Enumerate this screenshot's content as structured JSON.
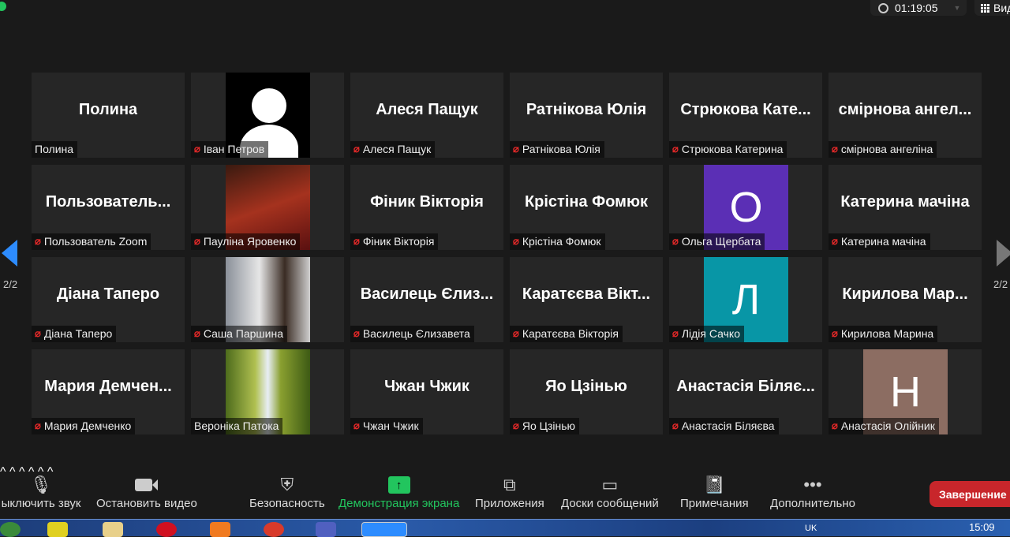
{
  "header": {
    "timer": "01:19:05",
    "view_label": "Вид"
  },
  "pagination": {
    "left": "2/2",
    "right": "2/2"
  },
  "colors": {
    "accent": "#2d8cff",
    "mute": "#e02828",
    "share": "#22c55e",
    "end": "#c8262b"
  },
  "tiles": [
    {
      "display": "Полина",
      "label": "Полина",
      "muted": false,
      "type": "text"
    },
    {
      "display": "",
      "label": "Іван Петров",
      "muted": true,
      "type": "avatar"
    },
    {
      "display": "Алеся Пащук",
      "label": "Алеся Пащук",
      "muted": true,
      "type": "text"
    },
    {
      "display": "Ратнікова Юлія",
      "label": "Ратнікова Юлія",
      "muted": true,
      "type": "text"
    },
    {
      "display": "Стрюкова Кате...",
      "label": "Стрюкова Катерина",
      "muted": true,
      "type": "text"
    },
    {
      "display": "смірнова ангел...",
      "label": "смірнова ангеліна",
      "muted": true,
      "type": "text"
    },
    {
      "display": "Пользователь...",
      "label": "Пользователь Zoom",
      "muted": true,
      "type": "text"
    },
    {
      "display": "",
      "label": "Пауліна Яровенко",
      "muted": true,
      "type": "photo",
      "bg": "linear-gradient(160deg,#3a1a10,#a5321e 50%,#5a1010)"
    },
    {
      "display": "Фіник Вікторія",
      "label": "Фіник Вікторія",
      "muted": true,
      "type": "text"
    },
    {
      "display": "Крістіна Фомюк",
      "label": "Крістіна Фомюк",
      "muted": true,
      "type": "text"
    },
    {
      "display": "О",
      "label": "Ольга Щербата",
      "muted": true,
      "type": "letter",
      "bg": "#5b2fb5"
    },
    {
      "display": "Катерина мачіна",
      "label": "Катерина мачіна",
      "muted": true,
      "type": "text"
    },
    {
      "display": "Діана Таперо",
      "label": "Діана Таперо",
      "muted": true,
      "type": "text"
    },
    {
      "display": "",
      "label": "Саша Паршина",
      "muted": true,
      "type": "photo",
      "bg": "linear-gradient(90deg,#8a9099,#e6e6e6 40%,#3a2c24 70%,#cfcfcf)"
    },
    {
      "display": "Василець Єлиз...",
      "label": "Василець Єлизавета",
      "muted": true,
      "type": "text"
    },
    {
      "display": "Каратєєва Вікт...",
      "label": "Каратєєва Вікторія",
      "muted": true,
      "type": "text"
    },
    {
      "display": "Л",
      "label": "Лідія Сачко",
      "muted": true,
      "type": "letter",
      "bg": "#0896a6"
    },
    {
      "display": "Кирилова Мар...",
      "label": "Кирилова Марина",
      "muted": true,
      "type": "text"
    },
    {
      "display": "Мария Демчен...",
      "label": "Мария Демченко",
      "muted": true,
      "type": "text"
    },
    {
      "display": "",
      "label": "Вероніка Патока",
      "muted": false,
      "type": "photo",
      "bg": "linear-gradient(90deg,#4d6b1c,#b0c050 35%,#e8eef5 50%,#8aa030 65%,#3d5a14)"
    },
    {
      "display": "Чжан Чжик",
      "label": "Чжан Чжик",
      "muted": true,
      "type": "text"
    },
    {
      "display": "Яо Цзінью",
      "label": "Яо Цзінью",
      "muted": true,
      "type": "text"
    },
    {
      "display": "Анастасія Біляє...",
      "label": "Анастасія Біляєва",
      "muted": true,
      "type": "text"
    },
    {
      "display": "Н",
      "label": "Анастасія Олійник",
      "muted": true,
      "type": "letter",
      "bg": "#8c6d62"
    }
  ],
  "toolbar": {
    "mute": "ыключить звук",
    "video": "Остановить видео",
    "security": "Безопасность",
    "share": "Демонстрация экрана",
    "apps": "Приложения",
    "whiteboards": "Доски сообщений",
    "notes": "Примечания",
    "more": "Дополнительно",
    "end": "Завершение"
  },
  "taskbar": {
    "lang": "UK",
    "time": "15:09"
  }
}
